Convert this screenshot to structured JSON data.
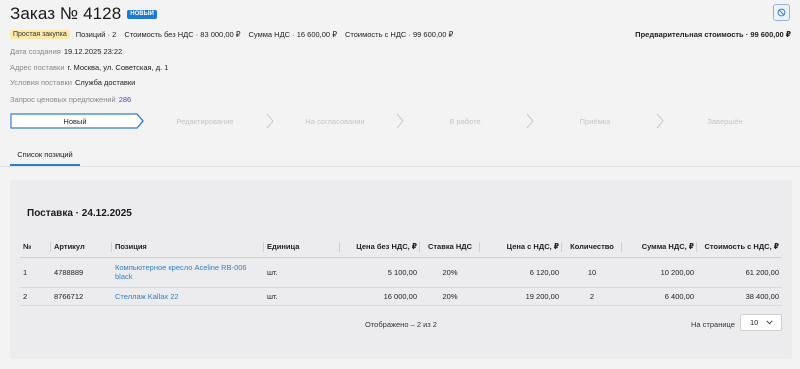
{
  "order": {
    "title": "Заказ № 4128",
    "status_badge": "НОВЫЙ",
    "purchase_type": "Простая закупка",
    "positions": "Позиций · 2",
    "cost_without_vat": "Стоимость без НДС · 83 000,00 ₽",
    "vat_sum": "Сумма НДС · 16 600,00 ₽",
    "cost_with_vat": "Стоимость с НДС · 99 600,00 ₽",
    "preliminary_cost": "Предварительная стоимость ·  99 600,00 ₽"
  },
  "info": {
    "created_label": "Дата создания",
    "created_value": "19.12.2025 23:22",
    "address_label": "Адрес поставки",
    "address_value": "г. Москва, ул. Советская, д. 1",
    "conditions_label": "Условия поставки",
    "conditions_value": "Служба доставки",
    "quotes_label": "Запрос ценовых предложений",
    "quotes_value": "286"
  },
  "steps": [
    "Новый",
    "Редактирование",
    "На согласовании",
    "В работе",
    "Приёмка",
    "Завершён"
  ],
  "active_step": 0,
  "tabs": {
    "positions": "Список позиций"
  },
  "delivery": {
    "title": "Поставка · 24.12.2025",
    "columns": [
      "№",
      "Артикул",
      "Позиция",
      "Единица",
      "Цена без НДС, ₽",
      "Ставка НДС",
      "Цена с НДС, ₽",
      "Количество",
      "Сумма НДС, ₽",
      "Стоимость с НДС, ₽"
    ],
    "rows": [
      {
        "n": "1",
        "article": "4788889",
        "position": "Компьютерное кресло Aceline RB-006 black",
        "unit": "шт.",
        "price": "5 100,00",
        "vat_rate": "20%",
        "price_vat": "6 120,00",
        "qty": "10",
        "vat_sum": "10 200,00",
        "total": "61 200,00"
      },
      {
        "n": "2",
        "article": "8766712",
        "position": "Стеллаж Kallax 22",
        "unit": "шт.",
        "price": "16 000,00",
        "vat_rate": "20%",
        "price_vat": "19 200,00",
        "qty": "2",
        "vat_sum": "6 400,00",
        "total": "38 400,00"
      }
    ],
    "shown_text": "Отображено – 2 из 2",
    "per_page_label": "На странице",
    "per_page_value": "10"
  },
  "colors": {
    "accent": "#2f7fd0",
    "badge": "#1f7ad3",
    "chip": "#ffe9a8",
    "link_purple": "#5a3fb8"
  },
  "icons": {
    "corner": "block-icon",
    "select": "chevron-down-icon"
  }
}
